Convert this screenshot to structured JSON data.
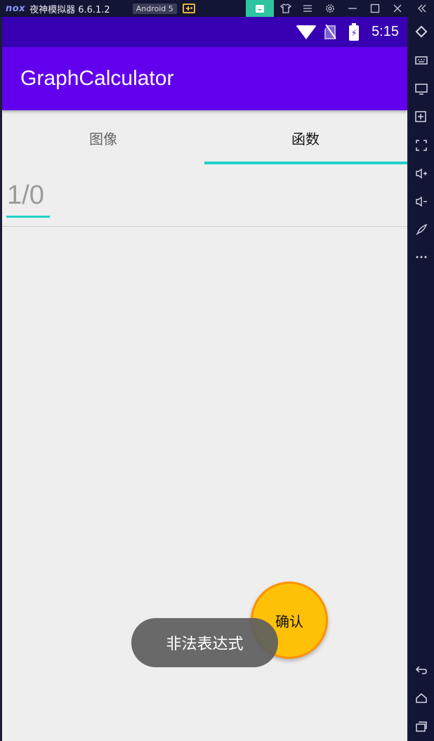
{
  "emulator": {
    "logo": "nox",
    "name": "夜神模拟器 6.6.1.2",
    "android_badge": "Android 5",
    "titlebar_icons": [
      "store-icon",
      "shirt-icon",
      "menu-icon",
      "settings-icon",
      "minimize-icon",
      "maximize-icon",
      "close-icon",
      "collapse-icon"
    ],
    "sidebar_icons": [
      "rotate-icon",
      "keyboard-icon",
      "screen-icon",
      "apk-install-icon",
      "fullscreen-icon",
      "volume-up-icon",
      "volume-down-icon",
      "rocket-icon",
      "more-icon",
      "back-icon",
      "home-icon",
      "recents-icon"
    ]
  },
  "statusbar": {
    "time": "5:15"
  },
  "appbar": {
    "title": "GraphCalculator"
  },
  "tabs": [
    {
      "label": "图像",
      "selected": false
    },
    {
      "label": "函数",
      "selected": true
    }
  ],
  "expression": {
    "value": "1/0"
  },
  "fab": {
    "label": "确认"
  },
  "toast": {
    "message": "非法表达式"
  },
  "colors": {
    "statusbar": "#3700b3",
    "appbar": "#6200ee",
    "accent": "#1fd1c6",
    "fab": "#ffc107",
    "fab_border": "#ff9100"
  }
}
